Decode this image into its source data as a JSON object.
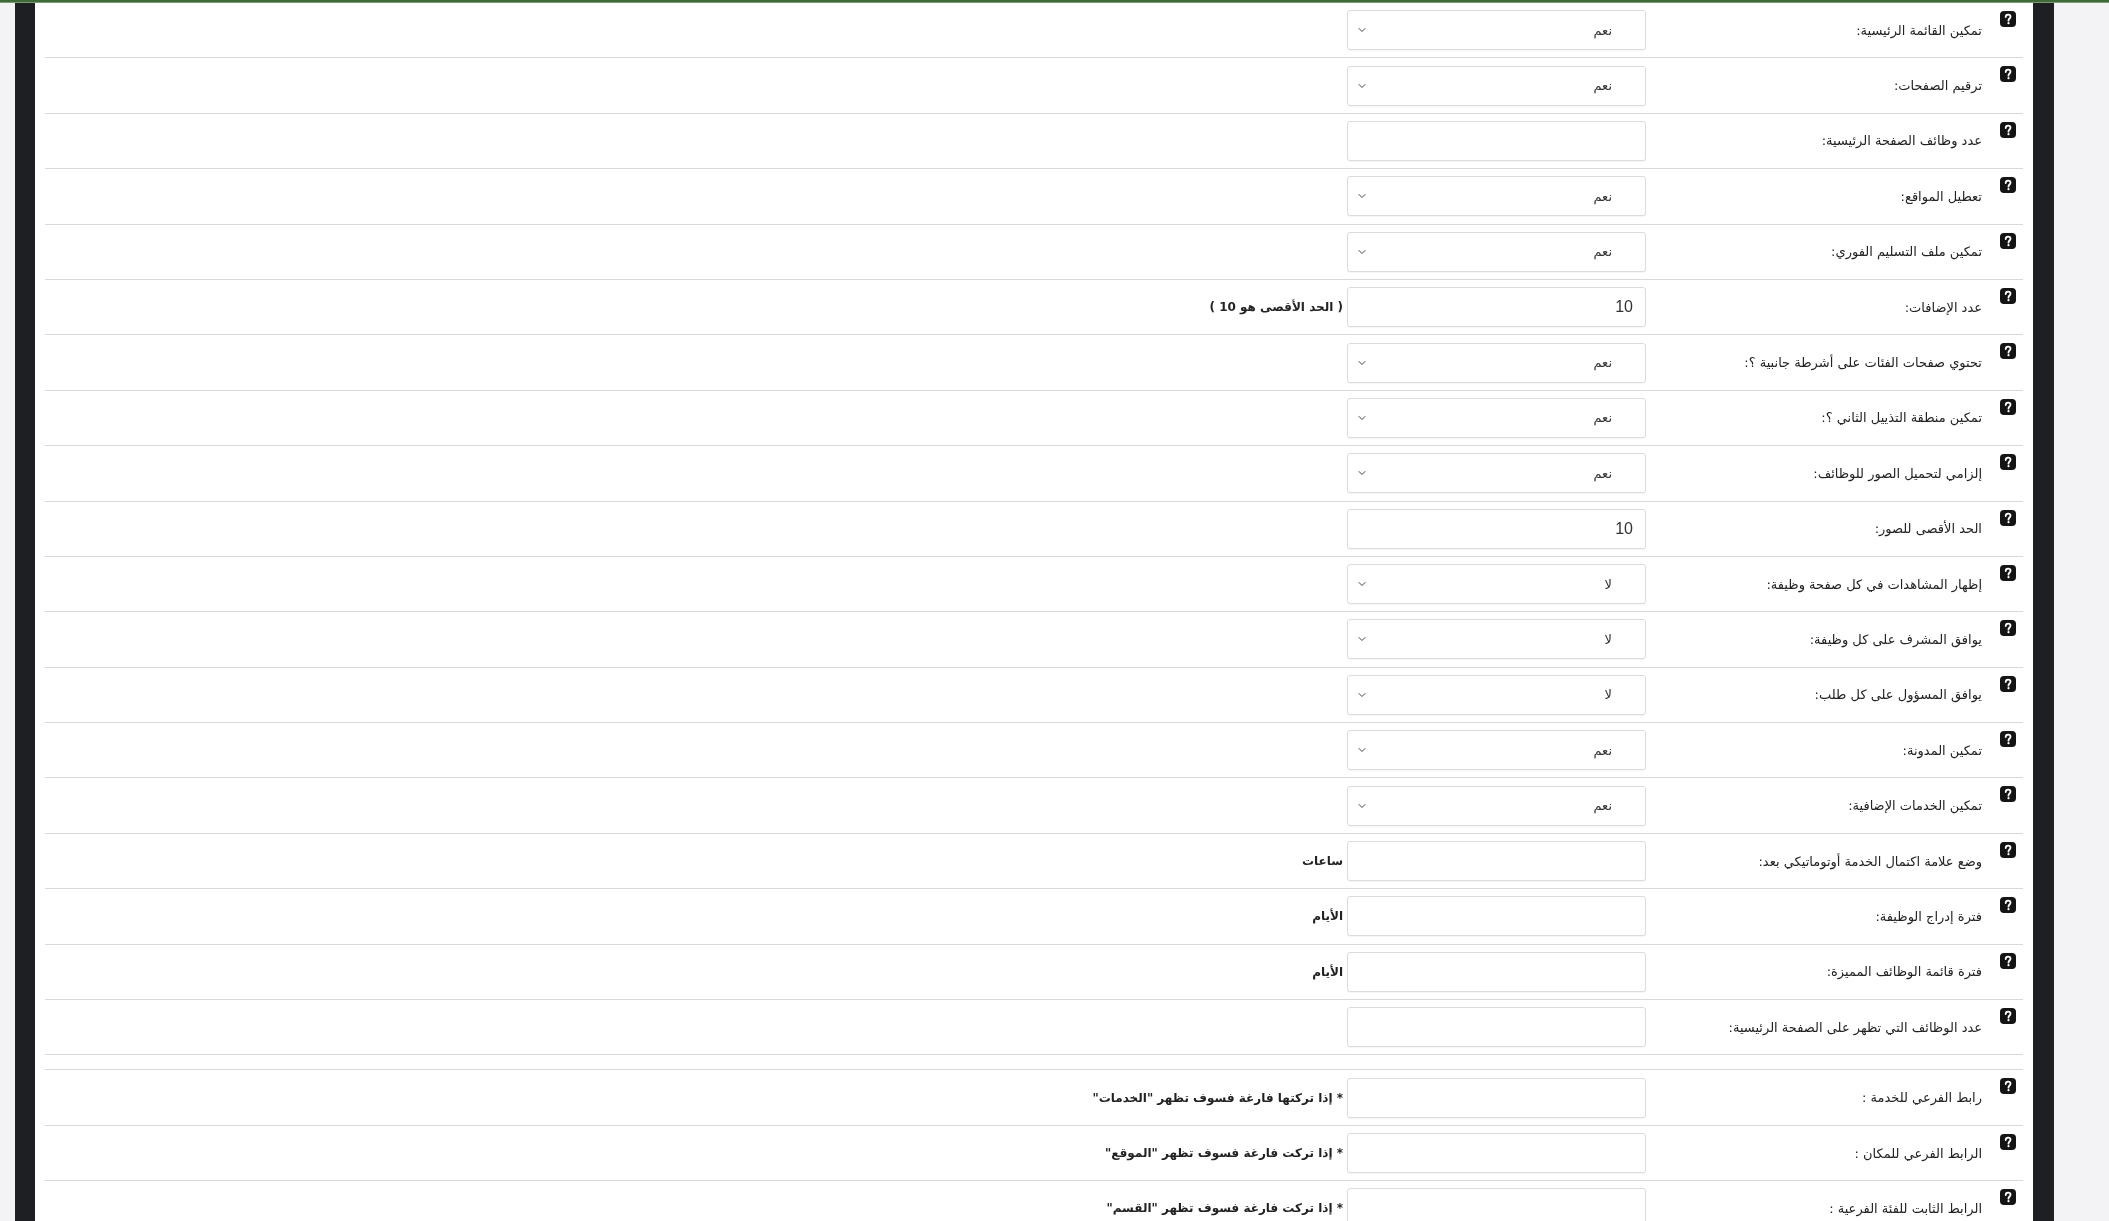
{
  "sections": [
    {
      "rows": [
        {
          "label": "تمكين القائمة الرئيسية:",
          "kind": "select",
          "value": "نعم"
        },
        {
          "label": "ترقيم الصفحات:",
          "kind": "select",
          "value": "نعم"
        },
        {
          "label": "عدد وظائف الصفحة الرئيسية:",
          "kind": "input"
        },
        {
          "label": "تعطيل المواقع:",
          "kind": "select",
          "value": "نعم"
        },
        {
          "label": "تمكين ملف التسليم الفوري:",
          "kind": "select",
          "value": "نعم"
        },
        {
          "label": "عدد الإضافات:",
          "kind": "input",
          "value": "10",
          "note": "( الحد الأقصى هو 10 )"
        },
        {
          "label": "تحتوي صفحات الفئات على أشرطة جانبية ؟:",
          "kind": "select",
          "value": "نعم"
        },
        {
          "label": "تمكين منطقة التذييل الثاني ؟:",
          "kind": "select",
          "value": "نعم"
        },
        {
          "label": "إلزامي لتحميل الصور للوظائف:",
          "kind": "select",
          "value": "نعم"
        },
        {
          "label": "الحد الأقصى للصور:",
          "kind": "input",
          "value": "10"
        },
        {
          "label": "إظهار المشاهدات في كل صفحة وظيفة:",
          "kind": "select",
          "value": "لا"
        },
        {
          "label": "يوافق المشرف على كل وظيفة:",
          "kind": "select",
          "value": "لا"
        },
        {
          "label": "يوافق المسؤول على كل طلب:",
          "kind": "select",
          "value": "لا"
        },
        {
          "label": "تمكين المدونة:",
          "kind": "select",
          "value": "نعم"
        },
        {
          "label": "تمكين الخدمات الإضافية:",
          "kind": "select",
          "value": "نعم"
        },
        {
          "label": "وضع علامة اكتمال الخدمة أوتوماتيكي بعد:",
          "kind": "input",
          "note": "ساعات"
        },
        {
          "label": "فترة إدراج الوظيفة:",
          "kind": "input",
          "note": "الأيام"
        },
        {
          "label": "فترة قائمة الوظائف المميزة:",
          "kind": "input",
          "note": "الأيام"
        },
        {
          "label": "عدد الوظائف التي تظهر على الصفحة الرئيسية:",
          "kind": "input"
        }
      ]
    },
    {
      "rows": [
        {
          "label": "رابط الفرعي للخدمة :",
          "kind": "input",
          "note": "* إذا تركتها فارغة فسوف تظهر \"الخدمات\""
        },
        {
          "label": "الرابط الفرعي للمكان :",
          "kind": "input",
          "note": "* إذا تركت فارغة فسوف تظهر \"الموقع\""
        },
        {
          "label": "الرابط الثابت للفئة الفرعية :",
          "kind": "input",
          "note": "* إذا تركت فارغة فسوف تظهر \"القسم\""
        }
      ]
    }
  ]
}
